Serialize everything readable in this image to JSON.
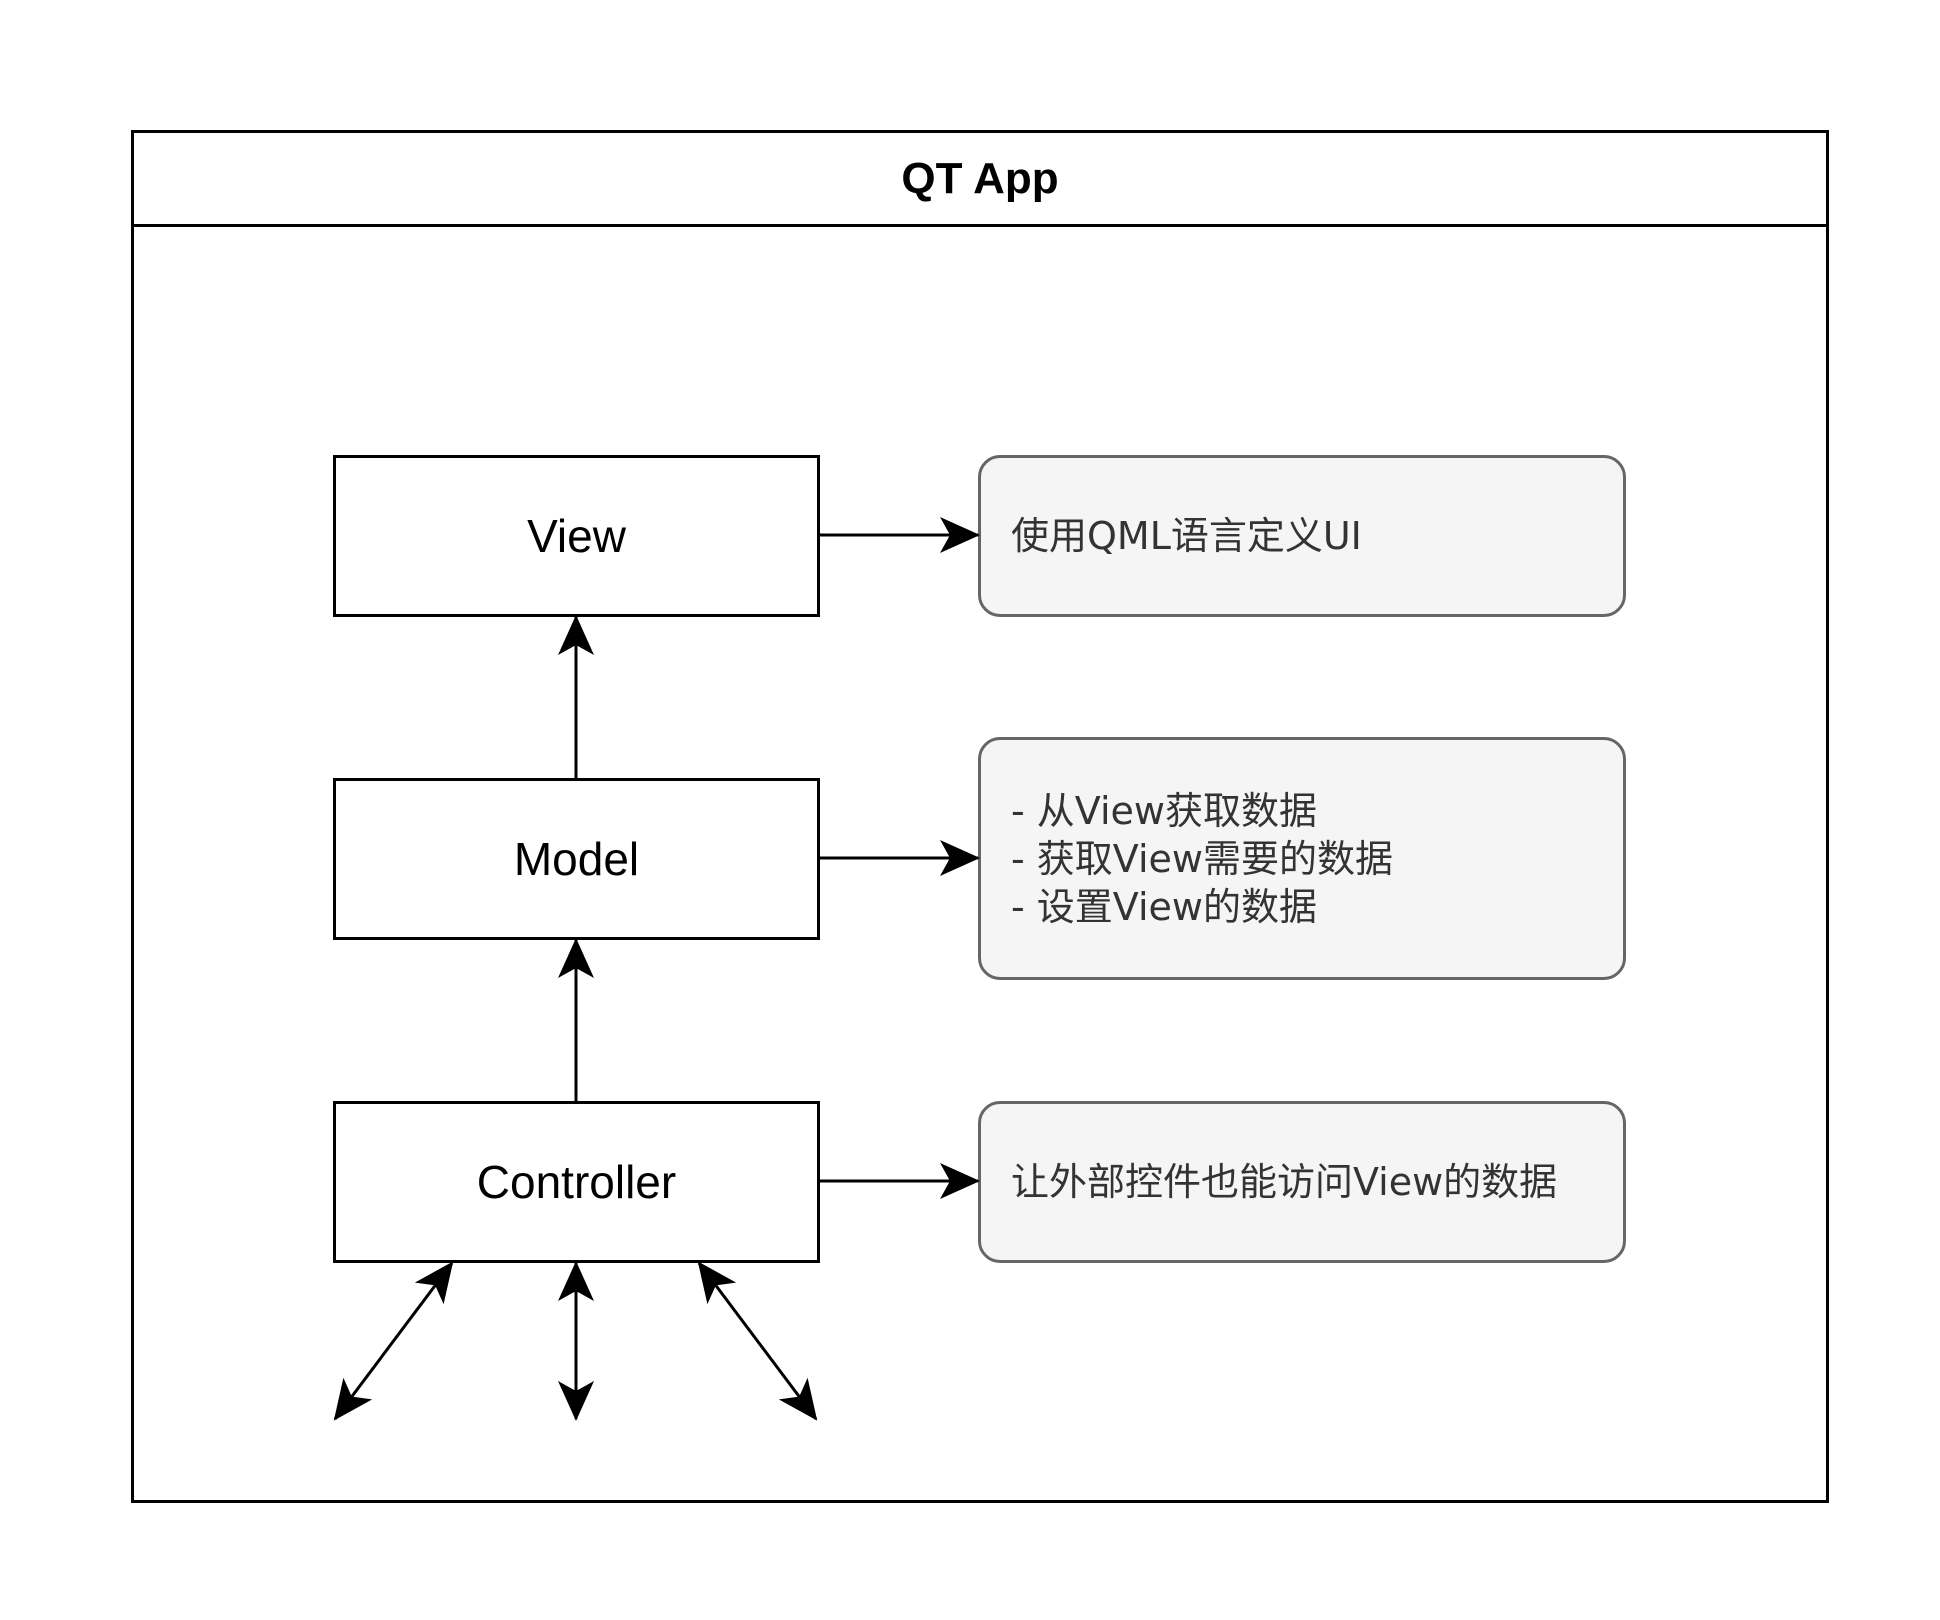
{
  "container": {
    "title": "QT App"
  },
  "boxes": {
    "view": "View",
    "model": "Model",
    "controller": "Controller"
  },
  "notes": {
    "view": [
      "使用QML语言定义UI"
    ],
    "model": [
      "- 从View获取数据",
      "- 获取View需要的数据",
      "- 设置View的数据"
    ],
    "controller": [
      "让外部控件也能访问View的数据"
    ]
  },
  "colors": {
    "stroke": "#000000",
    "note_fill": "#f5f5f5",
    "note_border": "#666666",
    "note_text": "#333333"
  }
}
